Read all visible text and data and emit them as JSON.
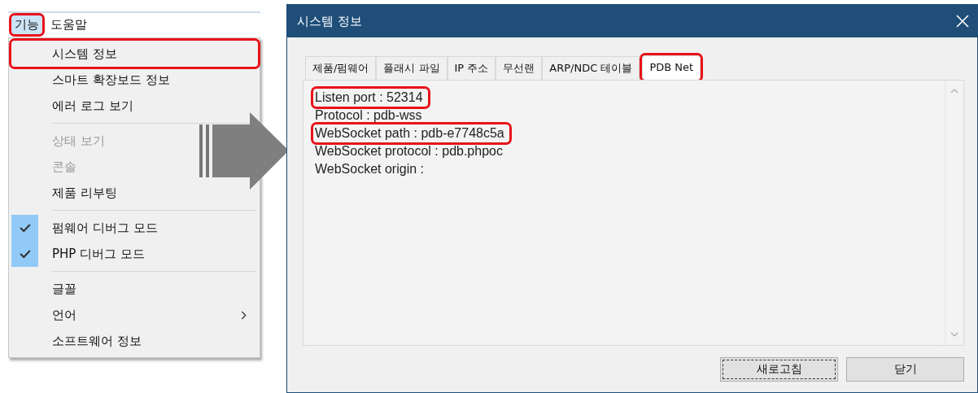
{
  "menu_bar": [
    {
      "label": "기능",
      "selected": true,
      "highlighted": true
    },
    {
      "label": "도움말",
      "selected": false,
      "highlighted": false
    }
  ],
  "menu": [
    {
      "kind": "item",
      "label": "시스템 정보",
      "disabled": false,
      "checked": false,
      "submenu": false,
      "highlighted": true
    },
    {
      "kind": "item",
      "label": "스마트 확장보드 정보",
      "disabled": false,
      "checked": false,
      "submenu": false,
      "highlighted": false
    },
    {
      "kind": "item",
      "label": "에러 로그 보기",
      "disabled": false,
      "checked": false,
      "submenu": false,
      "highlighted": false
    },
    {
      "kind": "separator"
    },
    {
      "kind": "item",
      "label": "상태 보기",
      "disabled": true,
      "checked": false,
      "submenu": false,
      "highlighted": false
    },
    {
      "kind": "item",
      "label": "콘솔",
      "disabled": true,
      "checked": false,
      "submenu": false,
      "highlighted": false
    },
    {
      "kind": "item",
      "label": "제품 리부팅",
      "disabled": false,
      "checked": false,
      "submenu": false,
      "highlighted": false
    },
    {
      "kind": "separator"
    },
    {
      "kind": "item",
      "label": "펌웨어 디버그 모드",
      "disabled": false,
      "checked": true,
      "submenu": false,
      "highlighted": false
    },
    {
      "kind": "item",
      "label": "PHP 디버그 모드",
      "disabled": false,
      "checked": true,
      "submenu": false,
      "highlighted": false
    },
    {
      "kind": "separator"
    },
    {
      "kind": "item",
      "label": "글꼴",
      "disabled": false,
      "checked": false,
      "submenu": false,
      "highlighted": false
    },
    {
      "kind": "item",
      "label": "언어",
      "disabled": false,
      "checked": false,
      "submenu": true,
      "highlighted": false
    },
    {
      "kind": "item",
      "label": "소프트웨어 정보",
      "disabled": false,
      "checked": false,
      "submenu": false,
      "highlighted": false
    }
  ],
  "dialog": {
    "title": "시스템 정보",
    "tabs": [
      {
        "label": "제품/펌웨어",
        "selected": false,
        "highlighted": false
      },
      {
        "label": "플래시 파일",
        "selected": false,
        "highlighted": false
      },
      {
        "label": "IP 주소",
        "selected": false,
        "highlighted": false
      },
      {
        "label": "무선랜",
        "selected": false,
        "highlighted": false
      },
      {
        "label": "ARP/NDC 테이블",
        "selected": false,
        "highlighted": false
      },
      {
        "label": "PDB Net",
        "selected": true,
        "highlighted": true
      }
    ],
    "lines": [
      {
        "text": "Listen port : 52314",
        "highlighted": true
      },
      {
        "text": "Protocol : pdb-wss",
        "highlighted": false
      },
      {
        "text": "WebSocket path : pdb-e7748c5a",
        "highlighted": true
      },
      {
        "text": "WebSocket protocol : pdb.phpoc",
        "highlighted": false
      },
      {
        "text": "WebSocket origin :",
        "highlighted": false
      }
    ],
    "buttons": [
      {
        "label": "새로고침",
        "focused": true
      },
      {
        "label": "닫기",
        "focused": false
      }
    ]
  }
}
